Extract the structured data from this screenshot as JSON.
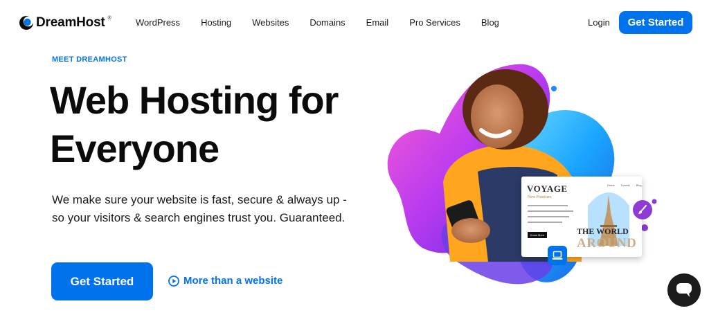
{
  "brand": {
    "name": "DreamHost",
    "trademark": "®",
    "accent": "#0073ec"
  },
  "nav": {
    "items": [
      {
        "label": "WordPress"
      },
      {
        "label": "Hosting"
      },
      {
        "label": "Websites"
      },
      {
        "label": "Domains"
      },
      {
        "label": "Email"
      },
      {
        "label": "Pro Services"
      },
      {
        "label": "Blog"
      }
    ],
    "login": "Login",
    "cta": "Get Started"
  },
  "hero": {
    "eyebrow": "MEET DREAMHOST",
    "title": "Web Hosting for Everyone",
    "subtitle": "We make sure your website is fast, secure & always up - so your visitors & search engines trust you. Guaranteed.",
    "primary_cta": "Get Started",
    "secondary_cta": "More than a website"
  },
  "mockup": {
    "title": "VOYAGE",
    "subtitle": "New Frontiers",
    "nav": [
      "Home",
      "Travels",
      "Blog"
    ],
    "button": "Know More",
    "headline_1": "THE WORLD",
    "headline_2": "AROUND"
  },
  "icons": {
    "logo": "dreamhost-moon-icon",
    "play": "play-circle-icon",
    "brush": "paintbrush-icon",
    "laptop": "laptop-icon",
    "chat": "chat-bubble-icon"
  }
}
